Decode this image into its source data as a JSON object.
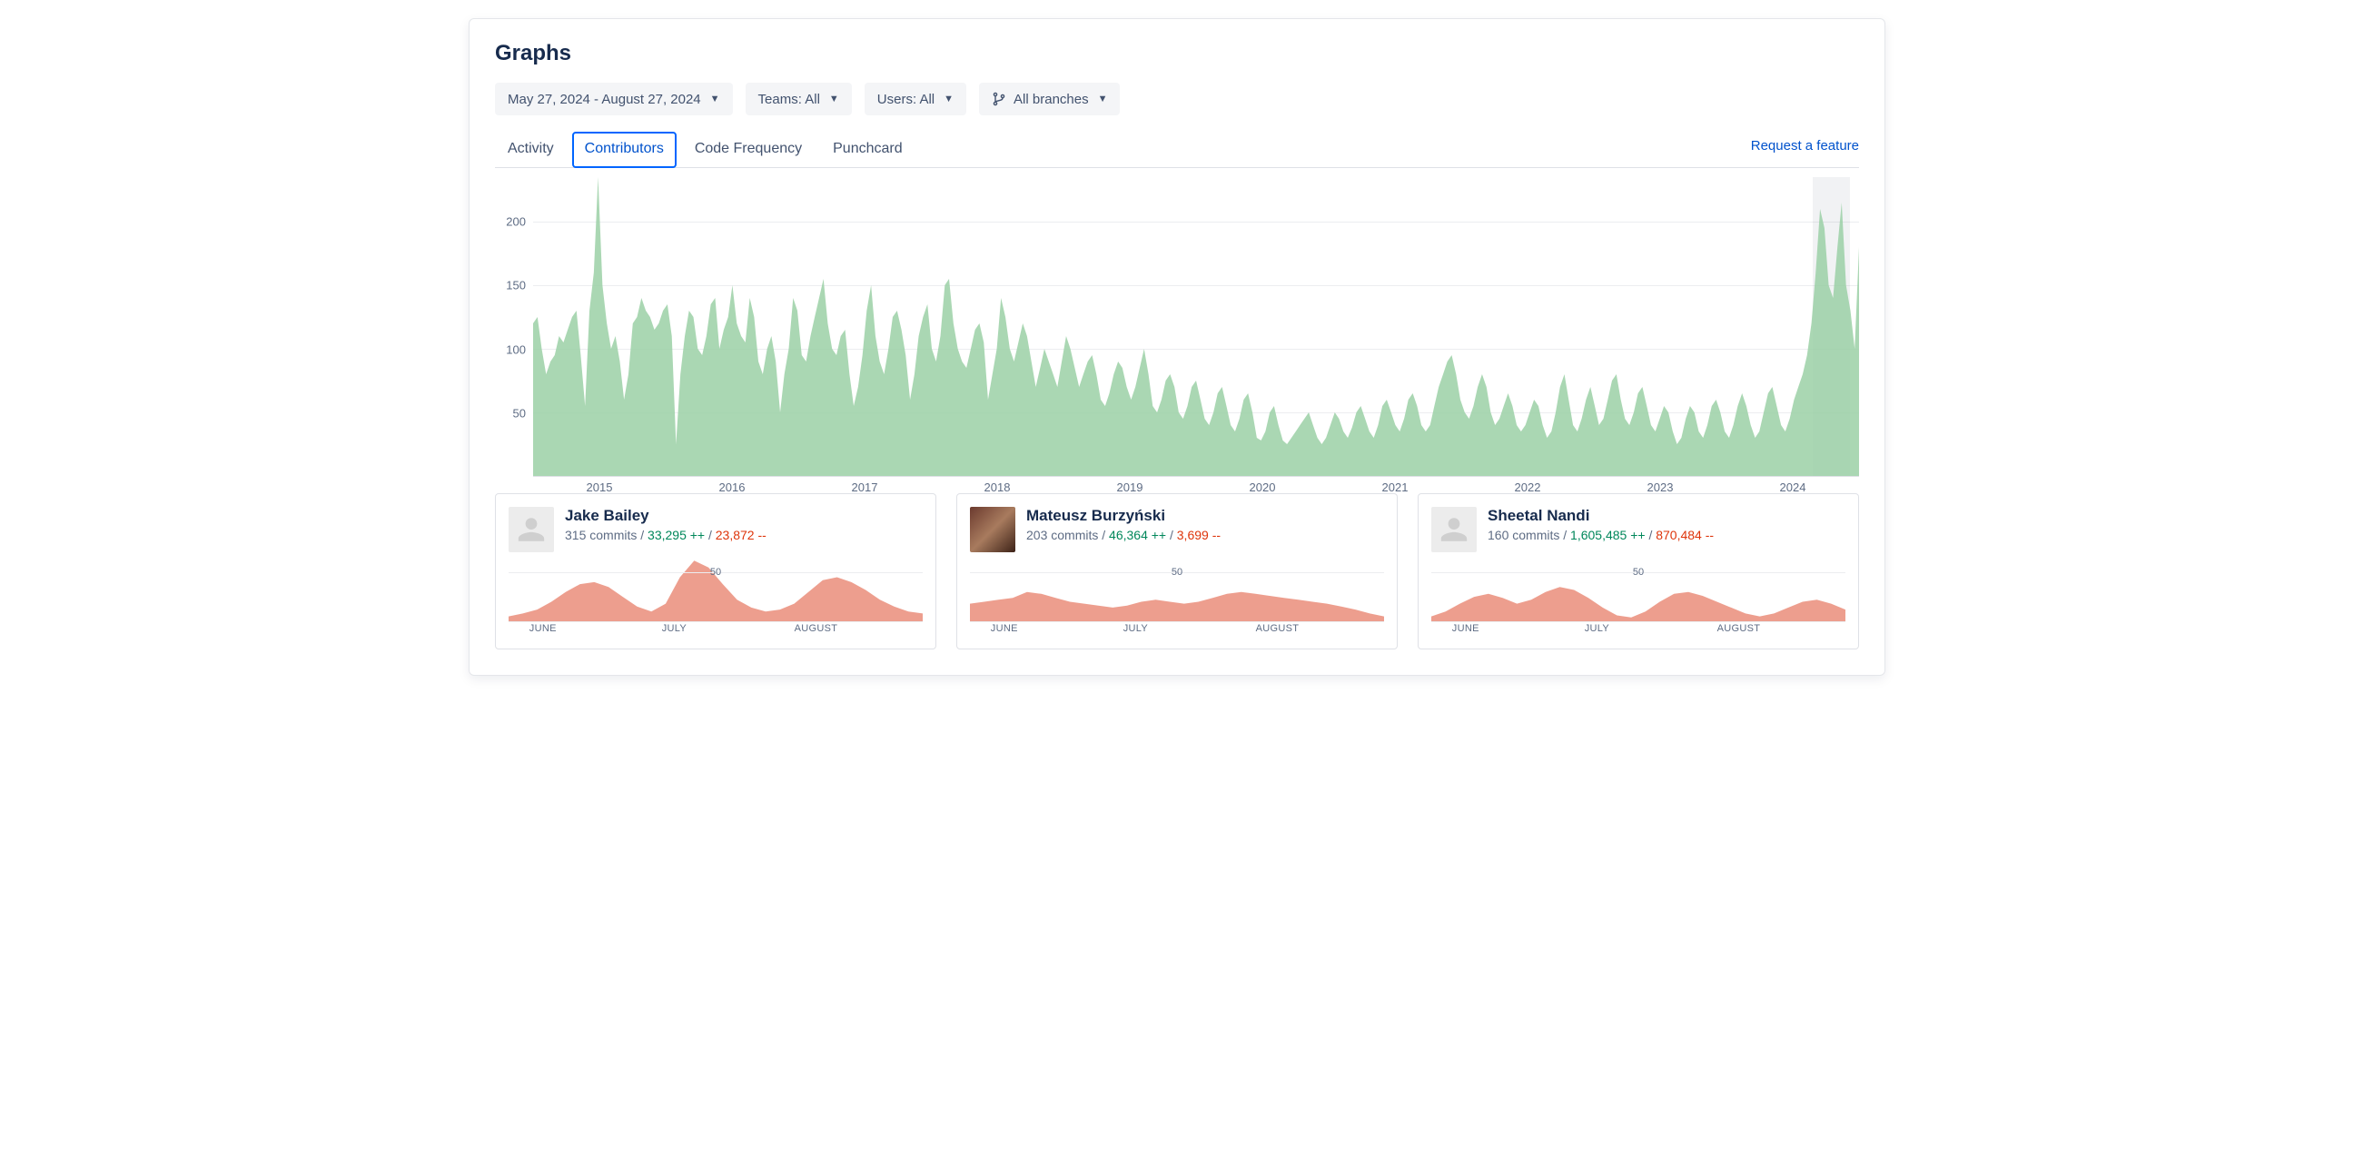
{
  "page_title": "Graphs",
  "filters": {
    "date_range": "May 27, 2024 - August 27, 2024",
    "teams": "Teams: All",
    "users": "Users: All",
    "branches": "All branches"
  },
  "tabs": {
    "activity": "Activity",
    "contributors": "Contributors",
    "code_frequency": "Code Frequency",
    "punchcard": "Punchcard",
    "active": "contributors"
  },
  "request_feature": "Request a feature",
  "chart_data": {
    "type": "area",
    "ylabel": "",
    "xlabel": "",
    "y_ticks": [
      50,
      100,
      150,
      200
    ],
    "ylim": [
      0,
      235
    ],
    "x_ticks": [
      "2015",
      "2016",
      "2017",
      "2018",
      "2019",
      "2020",
      "2021",
      "2022",
      "2023",
      "2024"
    ],
    "selection_band": {
      "start_pct": 96.5,
      "end_pct": 99.3
    },
    "values": [
      120,
      125,
      100,
      80,
      90,
      95,
      110,
      105,
      115,
      125,
      130,
      95,
      55,
      130,
      160,
      235,
      150,
      120,
      100,
      110,
      90,
      60,
      80,
      120,
      125,
      140,
      130,
      125,
      115,
      120,
      130,
      135,
      110,
      25,
      80,
      110,
      130,
      125,
      100,
      95,
      110,
      135,
      140,
      100,
      115,
      125,
      150,
      120,
      110,
      105,
      140,
      125,
      90,
      80,
      100,
      110,
      90,
      50,
      80,
      100,
      140,
      130,
      95,
      90,
      110,
      125,
      140,
      155,
      120,
      100,
      95,
      110,
      115,
      80,
      55,
      70,
      95,
      130,
      150,
      110,
      90,
      80,
      100,
      125,
      130,
      115,
      95,
      60,
      80,
      110,
      125,
      135,
      100,
      90,
      110,
      150,
      155,
      120,
      100,
      90,
      85,
      100,
      115,
      120,
      105,
      60,
      80,
      100,
      140,
      125,
      100,
      90,
      105,
      120,
      110,
      90,
      70,
      85,
      100,
      90,
      80,
      70,
      90,
      110,
      100,
      85,
      70,
      80,
      90,
      95,
      80,
      60,
      55,
      65,
      80,
      90,
      85,
      70,
      60,
      70,
      85,
      100,
      80,
      55,
      50,
      60,
      75,
      80,
      70,
      50,
      45,
      55,
      70,
      75,
      60,
      45,
      40,
      50,
      65,
      70,
      55,
      40,
      35,
      45,
      60,
      65,
      50,
      30,
      28,
      35,
      50,
      55,
      40,
      28,
      25,
      30,
      35,
      40,
      45,
      50,
      40,
      30,
      25,
      30,
      40,
      50,
      45,
      35,
      30,
      38,
      50,
      55,
      45,
      35,
      30,
      40,
      55,
      60,
      50,
      40,
      35,
      45,
      60,
      65,
      55,
      40,
      35,
      40,
      55,
      70,
      80,
      90,
      95,
      80,
      60,
      50,
      45,
      55,
      70,
      80,
      70,
      50,
      40,
      45,
      55,
      65,
      55,
      40,
      35,
      40,
      50,
      60,
      55,
      40,
      30,
      35,
      50,
      70,
      80,
      60,
      40,
      35,
      45,
      60,
      70,
      55,
      40,
      45,
      60,
      75,
      80,
      60,
      45,
      40,
      50,
      65,
      70,
      55,
      40,
      35,
      45,
      55,
      50,
      35,
      25,
      30,
      45,
      55,
      50,
      35,
      30,
      40,
      55,
      60,
      50,
      35,
      30,
      40,
      55,
      65,
      55,
      40,
      30,
      35,
      50,
      65,
      70,
      55,
      40,
      35,
      45,
      60,
      70,
      80,
      95,
      120,
      160,
      210,
      195,
      150,
      140,
      180,
      215,
      150,
      130,
      100,
      180
    ]
  },
  "contributors": [
    {
      "name": "Jake Bailey",
      "commits_label": "315 commits",
      "additions": "33,295 ++",
      "deletions": "23,872 --",
      "avatar": "blank",
      "mini": {
        "type": "area",
        "ylim": [
          0,
          65
        ],
        "y_tick": 50,
        "x_ticks": [
          "JUNE",
          "JULY",
          "AUGUST"
        ],
        "values": [
          5,
          8,
          12,
          20,
          30,
          38,
          40,
          35,
          25,
          15,
          10,
          18,
          45,
          62,
          55,
          38,
          22,
          14,
          10,
          12,
          18,
          30,
          42,
          45,
          40,
          32,
          22,
          15,
          10,
          8
        ]
      }
    },
    {
      "name": "Mateusz Burzyński",
      "commits_label": "203 commits",
      "additions": "46,364 ++",
      "deletions": "3,699 --",
      "avatar": "photo",
      "mini": {
        "type": "area",
        "ylim": [
          0,
          65
        ],
        "y_tick": 50,
        "x_ticks": [
          "JUNE",
          "JULY",
          "AUGUST"
        ],
        "values": [
          18,
          20,
          22,
          24,
          30,
          28,
          24,
          20,
          18,
          16,
          14,
          16,
          20,
          22,
          20,
          18,
          20,
          24,
          28,
          30,
          28,
          26,
          24,
          22,
          20,
          18,
          15,
          12,
          8,
          5
        ]
      }
    },
    {
      "name": "Sheetal Nandi",
      "commits_label": "160 commits",
      "additions": "1,605,485 ++",
      "deletions": "870,484 --",
      "avatar": "blank",
      "mini": {
        "type": "area",
        "ylim": [
          0,
          65
        ],
        "y_tick": 50,
        "x_ticks": [
          "JUNE",
          "JULY",
          "AUGUST"
        ],
        "values": [
          5,
          10,
          18,
          25,
          28,
          24,
          18,
          22,
          30,
          35,
          32,
          24,
          14,
          6,
          4,
          10,
          20,
          28,
          30,
          26,
          20,
          14,
          8,
          5,
          8,
          14,
          20,
          22,
          18,
          12
        ]
      }
    }
  ]
}
